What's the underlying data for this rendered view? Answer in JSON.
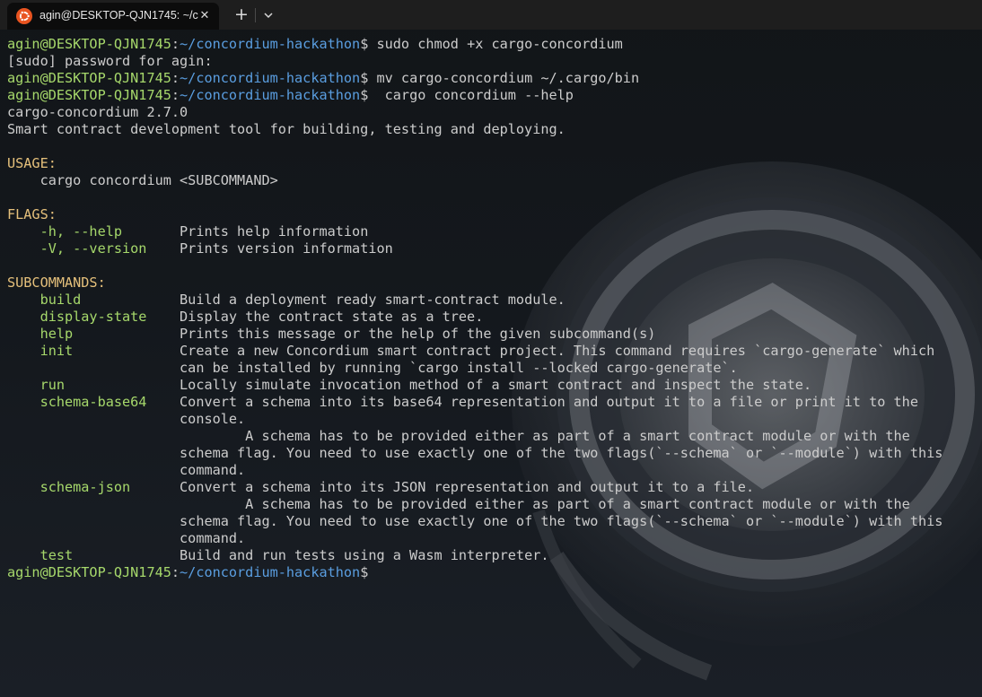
{
  "tab": {
    "title": "agin@DESKTOP-QJN1745: ~/c",
    "icon": "ubuntu-icon",
    "close_icon": "close-icon",
    "new_tab_icon": "plus-icon",
    "dropdown_icon": "chevron-down-icon"
  },
  "colors": {
    "user": "#a6d86b",
    "path": "#5a9ee0",
    "heading": "#e5c07b",
    "text": "#cccccc",
    "ubuntu": "#e95420"
  },
  "prompt": {
    "user": "agin@DESKTOP-QJN1745",
    "sep": ":",
    "path": "~/concordium-hackathon",
    "symbol": "$"
  },
  "commands": [
    " sudo chmod +x cargo-concordium",
    " mv cargo-concordium ~/.cargo/bin",
    "  cargo concordium --help"
  ],
  "output": {
    "sudo_prompt": "[sudo] password for agin:",
    "version_line": "cargo-concordium 2.7.0",
    "about": "Smart contract development tool for building, testing and deploying.",
    "usage_heading": "USAGE:",
    "usage_indent": "    ",
    "usage_text": "cargo concordium <SUBCOMMAND>",
    "flags_heading": "FLAGS:",
    "flags": [
      {
        "name": "    -h, --help       ",
        "desc": "Prints help information"
      },
      {
        "name": "    -V, --version    ",
        "desc": "Prints version information"
      }
    ],
    "subcommands_heading": "SUBCOMMANDS:",
    "subcommands": [
      {
        "name": "    build            ",
        "lines": [
          "Build a deployment ready smart-contract module."
        ]
      },
      {
        "name": "    display-state    ",
        "lines": [
          "Display the contract state as a tree."
        ]
      },
      {
        "name": "    help             ",
        "lines": [
          "Prints this message or the help of the given subcommand(s)"
        ]
      },
      {
        "name": "    init             ",
        "lines": [
          "Create a new Concordium smart contract project. This command requires `cargo-generate` which",
          "can be installed by running `cargo install --locked cargo-generate`."
        ]
      },
      {
        "name": "    run              ",
        "lines": [
          "Locally simulate invocation method of a smart contract and inspect the state."
        ]
      },
      {
        "name": "    schema-base64    ",
        "lines": [
          "Convert a schema into its base64 representation and output it to a file or print it to the",
          "console.",
          "        A schema has to be provided either as part of a smart contract module or with the",
          "schema flag. You need to use exactly one of the two flags(`--schema` or `--module`) with this",
          "command."
        ]
      },
      {
        "name": "    schema-json      ",
        "lines": [
          "Convert a schema into its JSON representation and output it to a file.",
          "        A schema has to be provided either as part of a smart contract module or with the",
          "schema flag. You need to use exactly one of the two flags(`--schema` or `--module`) with this",
          "command."
        ]
      },
      {
        "name": "    test             ",
        "lines": [
          "Build and run tests using a Wasm interpreter."
        ]
      }
    ],
    "continuation_indent": "                     "
  }
}
